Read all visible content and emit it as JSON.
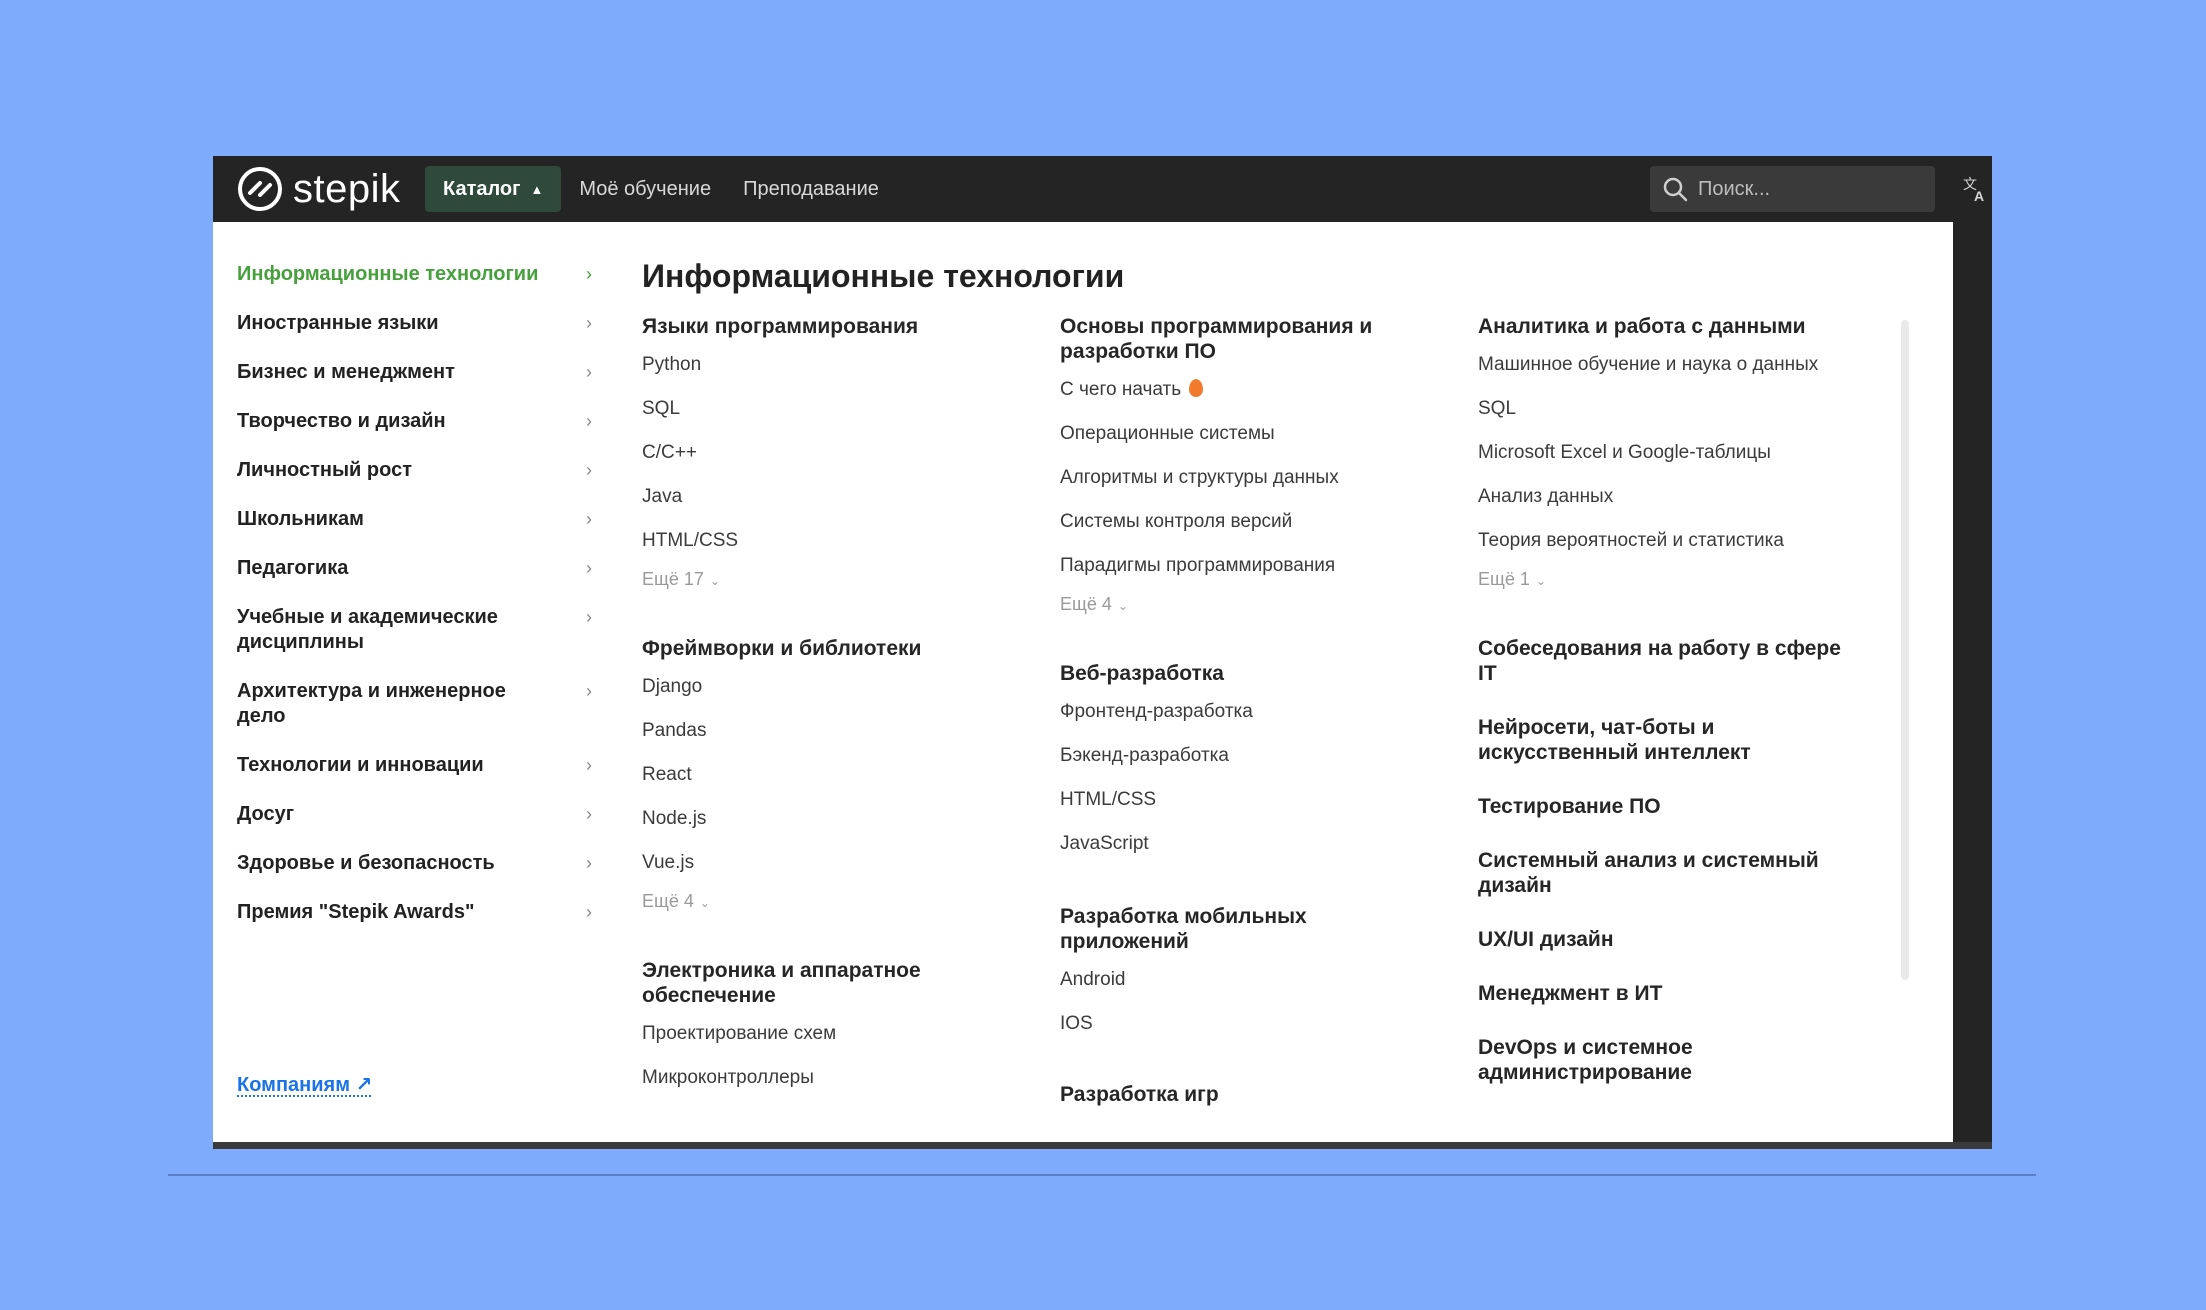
{
  "header": {
    "logo_text": "stepik",
    "nav": [
      {
        "label": "Каталог",
        "active": true
      },
      {
        "label": "Моё обучение"
      },
      {
        "label": "Преподавание"
      }
    ],
    "search_placeholder": "Поиск...",
    "lang_icon": "translate-icon"
  },
  "sidebar": {
    "categories": [
      "Информационные технологии",
      "Иностранные языки",
      "Бизнес и менеджмент",
      "Творчество и дизайн",
      "Личностный рост",
      "Школьникам",
      "Педагогика",
      "Учебные и академические дисциплины",
      "Архитектура и инженерное дело",
      "Технологии и инновации",
      "Досуг",
      "Здоровье и безопасность",
      "Премия \"Stepik Awards\""
    ],
    "companies_link": "Компаниям ↗"
  },
  "main": {
    "title": "Информационные технологии",
    "col1": {
      "g1": {
        "title": "Языки программирования",
        "items": [
          "Python",
          "SQL",
          "C/C++",
          "Java",
          "HTML/CSS"
        ],
        "more": "Ещё 17"
      },
      "g2": {
        "title": "Фреймворки и библиотеки",
        "items": [
          "Django",
          "Pandas",
          "React",
          "Node.js",
          "Vue.js"
        ],
        "more": "Ещё 4"
      },
      "g3": {
        "title": "Электроника и аппаратное обеспечение",
        "items": [
          "Проектирование схем",
          "Микроконтроллеры"
        ]
      }
    },
    "col2": {
      "g1": {
        "title": "Основы программирования и разработки ПО",
        "items": [
          "С чего начать",
          "Операционные системы",
          "Алгоритмы и структуры данных",
          "Системы контроля версий",
          "Парадигмы программирования"
        ],
        "more": "Ещё 4"
      },
      "g2": {
        "title": "Веб-разработка",
        "items": [
          "Фронтенд-разработка",
          "Бэкенд-разработка",
          "HTML/CSS",
          "JavaScript"
        ]
      },
      "g3": {
        "title": "Разработка мобильных приложений",
        "items": [
          "Android",
          "IOS"
        ]
      },
      "g4": {
        "title": "Разработка игр"
      }
    },
    "col3": {
      "g1": {
        "title": "Аналитика и работа с данными",
        "items": [
          "Машинное обучение и наука о данных",
          "SQL",
          "Microsoft Excel и Google-таблицы",
          "Анализ данных",
          "Теория вероятностей и статистика"
        ],
        "more": "Ещё 1"
      },
      "titles": [
        "Собеседования на работу в сфере IT",
        "Нейросети, чат-боты и искусственный интеллект",
        "Тестирование ПО",
        "Системный анализ и системный дизайн",
        "UX/UI дизайн",
        "Менеджмент в ИТ",
        "DevOps и системное администрирование"
      ]
    }
  },
  "colors": {
    "accent_green": "#46a03c",
    "link_blue": "#1b73e8",
    "topbar": "#242424",
    "background": "#7fabfd"
  }
}
